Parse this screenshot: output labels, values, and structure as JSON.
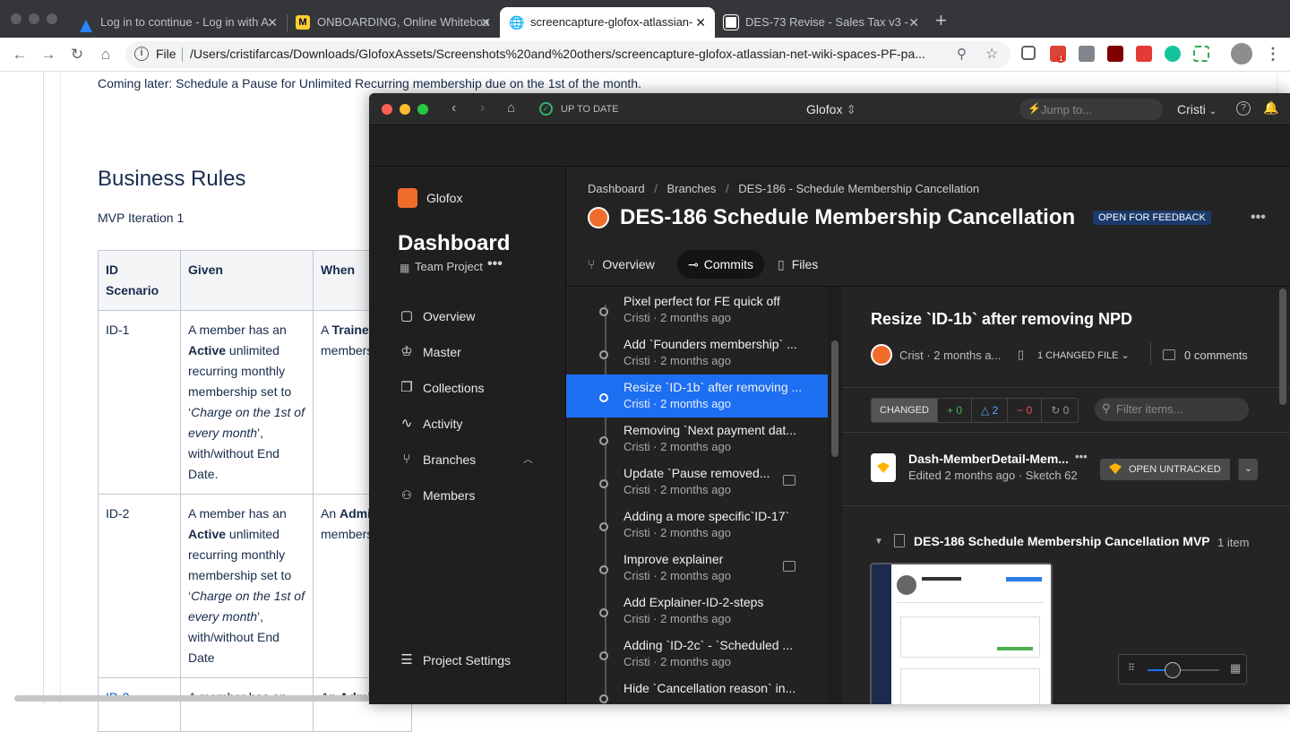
{
  "browser": {
    "tabs": [
      {
        "title": "Log in to continue - Log in with A",
        "color": "#2684ff"
      },
      {
        "title": "ONBOARDING, Online Whiteboa",
        "color": "#ffd02f"
      },
      {
        "title": "screencapture-glofox-atlassian-",
        "color": "#5f6368"
      },
      {
        "title": "DES-73 Revise - Sales Tax v3 - ",
        "color": "#ffffff"
      }
    ],
    "file_label": "File",
    "url": "/Users/cristifarcas/Downloads/GlofoxAssets/Screenshots%20and%20others/screencapture-glofox-atlassian-net-wiki-spaces-PF-pa...",
    "gmail_badge": "1"
  },
  "confluence": {
    "coming_later": "Coming later: Schedule a Pause for Unlimited Recurring membership due on the 1st of the month.",
    "heading": "Business Rules",
    "mvp": "MVP Iteration 1",
    "headers": [
      "ID Scenario",
      "Given",
      "When"
    ],
    "rows": [
      {
        "id": "ID-1",
        "given_a": "A member has an ",
        "given_b": "Active",
        "given_c": " unlimited recurring monthly membership set to ‘",
        "given_d": "Charge on the 1st of every month",
        "given_e": "’, with/without End Date.",
        "when_a": "A ",
        "when_b": "Traine",
        "when_c": "members"
      },
      {
        "id": "ID-2",
        "given_a": "A member has an ",
        "given_b": "Active",
        "given_c": " unlimited recurring monthly membership set to ‘",
        "given_d": "Charge on the 1st of every month",
        "given_e": "’, with/without End Date",
        "when_a": "An ",
        "when_b": "Admi",
        "when_c": "members"
      },
      {
        "id": "ID-3",
        "given_a": "A member has an",
        "when_a": "An ",
        "when_b": "Admi"
      }
    ]
  },
  "app": {
    "status": "UP TO DATE",
    "project": "Glofox",
    "jump_placeholder": "Jump to...",
    "user": "Cristi",
    "sidebar": {
      "org": "Glofox",
      "title": "Dashboard",
      "team": "Team Project",
      "items": [
        {
          "label": "Overview",
          "icon": "overview-icon",
          "glyph": "▢"
        },
        {
          "label": "Master",
          "icon": "crown-icon",
          "glyph": "♔"
        },
        {
          "label": "Collections",
          "icon": "collections-icon",
          "glyph": "❐"
        },
        {
          "label": "Activity",
          "icon": "activity-icon",
          "glyph": "∿"
        },
        {
          "label": "Branches",
          "icon": "branch-icon",
          "glyph": "⑂"
        },
        {
          "label": "Members",
          "icon": "person-icon",
          "glyph": "👤"
        }
      ],
      "settings": "Project Settings"
    },
    "breadcrumb": [
      "Dashboard",
      "Branches",
      "DES-186 - Schedule Membership Cancellation"
    ],
    "branch_title": "DES-186 Schedule Membership Cancellation",
    "branch_status": "OPEN FOR FEEDBACK",
    "tabs": [
      "Overview",
      "Commits",
      "Files"
    ],
    "commits": [
      {
        "title": "Pixel perfect for FE quick off",
        "meta": "Cristi · 2 months ago",
        "comment": false
      },
      {
        "title": "Add `Founders membership` ...",
        "meta": "Cristi · 2 months ago",
        "comment": false
      },
      {
        "title": "Resize `ID-1b` after removing ...",
        "meta": "Cristi · 2 months ago",
        "comment": false
      },
      {
        "title": "Removing `Next payment dat...",
        "meta": "Cristi · 2 months ago",
        "comment": false
      },
      {
        "title": "Update `Pause removed...",
        "meta": "Cristi · 2 months ago",
        "comment": true
      },
      {
        "title": "Adding a more specific`ID-17`",
        "meta": "Cristi · 2 months ago",
        "comment": false
      },
      {
        "title": "Improve explainer",
        "meta": "Cristi · 2 months ago",
        "comment": true
      },
      {
        "title": "Add Explainer-ID-2-steps",
        "meta": "Cristi · 2 months ago",
        "comment": false
      },
      {
        "title": "Adding `ID-2c` - `Scheduled ...",
        "meta": "Cristi · 2 months ago",
        "comment": false
      },
      {
        "title": "Hide `Cancellation reason` in...",
        "meta": "",
        "comment": false
      }
    ],
    "detail": {
      "title": "Resize `ID-1b` after removing NPD",
      "author": "Crist · 2 months a...",
      "changed_files": "1 CHANGED FILE",
      "comments": "0 comments",
      "filter_changed": "CHANGED",
      "added": "+ 0",
      "modified": "△ 2",
      "removed": "− 0",
      "moved": "↻ 0",
      "filter_placeholder": "Filter items...",
      "file_name": "Dash-MemberDetail-Mem...",
      "file_meta": "Edited 2 months ago · Sketch 62",
      "open_btn": "OPEN UNTRACKED",
      "collection_title": "DES-186 Schedule Membership Cancellation MVP",
      "collection_count": "1 item"
    }
  }
}
